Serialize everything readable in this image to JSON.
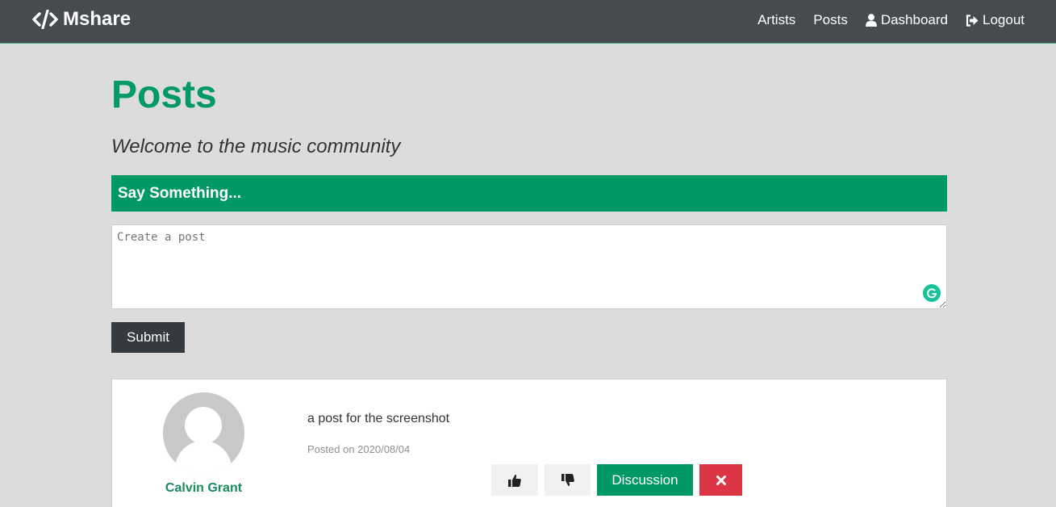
{
  "navbar": {
    "brand": "Mshare",
    "brand_icon": "code-icon",
    "links": [
      {
        "label": "Artists",
        "icon": null
      },
      {
        "label": "Posts",
        "icon": null
      },
      {
        "label": "Dashboard",
        "icon": "user-icon"
      },
      {
        "label": "Logout",
        "icon": "sign-out-icon"
      }
    ]
  },
  "page": {
    "title": "Posts",
    "lead": "Welcome to the music community"
  },
  "form": {
    "header": "Say Something...",
    "textarea_placeholder": "Create a post",
    "textarea_value": "",
    "submit_label": "Submit"
  },
  "post": {
    "author": "Calvin Grant",
    "text": "a post for the screenshot",
    "date_text": "Posted on 2020/08/04",
    "actions": {
      "like_icon": "thumbs-up-icon",
      "dislike_icon": "thumbs-down-icon",
      "discussion_label": "Discussion",
      "delete_icon": "times-icon"
    }
  },
  "colors": {
    "navbar_bg": "#464b50",
    "brand_green": "#009966",
    "page_bg": "#dcdcdc",
    "danger": "#dc3545",
    "dark_button": "#343a40"
  }
}
